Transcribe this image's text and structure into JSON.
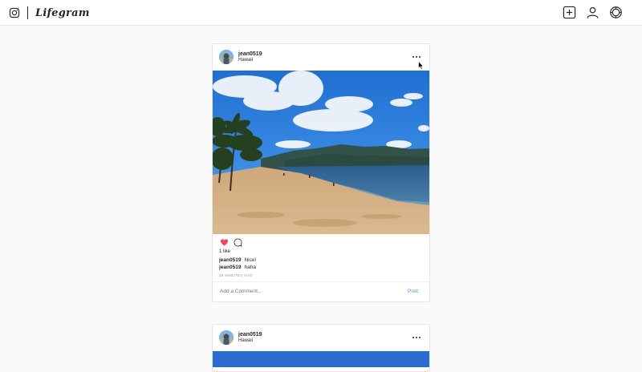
{
  "app": {
    "brand_name": "Lifegram",
    "icons": [
      "instagram-logo-icon",
      "new-post-icon",
      "profile-icon",
      "settings-icon"
    ]
  },
  "posts": [
    {
      "username": "jean0519",
      "location": "Hawaii",
      "likes_text": "1 like",
      "comments": [
        {
          "user": "jean0519",
          "text": "Nice!"
        },
        {
          "user": "jean0519",
          "text": "haha"
        }
      ],
      "time_ago": "38 MINUTES AGO",
      "comment_placeholder": "Add a Comment...",
      "post_label": "Post",
      "liked": true
    },
    {
      "username": "jean0519",
      "location": "Hawaii"
    }
  ],
  "colors": {
    "like_red": "#ed4956",
    "link_blue": "#3897f0",
    "muted": "#999999"
  }
}
